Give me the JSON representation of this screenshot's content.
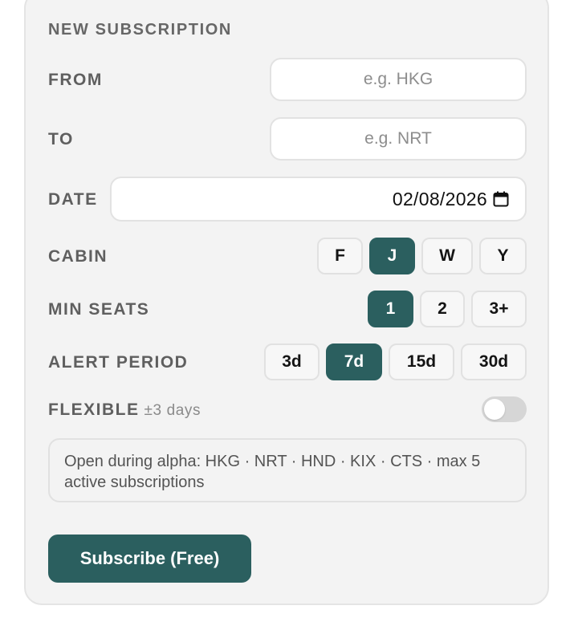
{
  "form": {
    "section_title": "NEW SUBSCRIPTION",
    "from_label": "FROM",
    "from_placeholder": "e.g. HKG",
    "from_value": "",
    "to_label": "TO",
    "to_placeholder": "e.g. NRT",
    "to_value": "",
    "date_label": "DATE",
    "date_value": "02/08/2026",
    "cabin_label": "CABIN",
    "cabin_options": [
      "F",
      "J",
      "W",
      "Y"
    ],
    "cabin_selected": "J",
    "seats_label": "MIN SEATS",
    "seats_options": [
      "1",
      "2",
      "3+"
    ],
    "seats_selected": "1",
    "period_label": "ALERT PERIOD",
    "period_options": [
      "3d",
      "7d",
      "15d",
      "30d"
    ],
    "period_selected": "7d",
    "flexible_label": "FLEXIBLE",
    "flexible_sub": "±3 days",
    "flexible_on": false,
    "notice_text": "Open during alpha: HKG · NRT · HND · KIX · CTS · max 5 active subscriptions",
    "subscribe_label": "Subscribe (Free)"
  },
  "colors": {
    "accent": "#2b5f5f",
    "panel_bg": "#f3f3f3",
    "label": "#5f5f5f"
  }
}
